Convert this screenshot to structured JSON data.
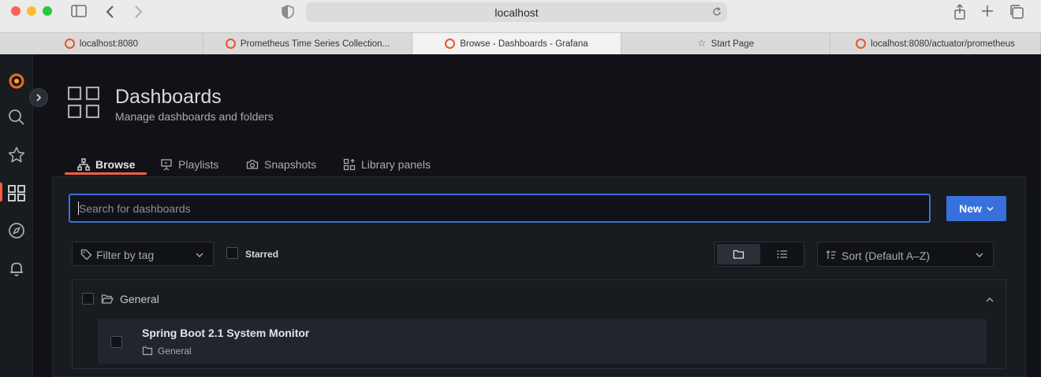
{
  "browser": {
    "url": "localhost",
    "tabs": [
      {
        "label": "localhost:8080",
        "icon": "grafana-icon"
      },
      {
        "label": "Prometheus Time Series Collection...",
        "icon": "grafana-icon"
      },
      {
        "label": "Browse - Dashboards - Grafana",
        "icon": "grafana-icon",
        "active": true
      },
      {
        "label": "Start Page",
        "icon": "star-icon"
      },
      {
        "label": "localhost:8080/actuator/prometheus",
        "icon": "grafana-icon"
      }
    ]
  },
  "header": {
    "title": "Dashboards",
    "subtitle": "Manage dashboards and folders"
  },
  "subtabs": [
    {
      "label": "Browse",
      "icon": "sitemap-icon",
      "active": true
    },
    {
      "label": "Playlists",
      "icon": "presentation-icon"
    },
    {
      "label": "Snapshots",
      "icon": "camera-icon"
    },
    {
      "label": "Library panels",
      "icon": "library-panel-icon"
    }
  ],
  "search": {
    "placeholder": "Search for dashboards"
  },
  "new_button": {
    "label": "New"
  },
  "filters": {
    "tag_placeholder": "Filter by tag",
    "starred_label": "Starred",
    "sort_label": "Sort (Default A–Z)"
  },
  "folder": {
    "name": "General"
  },
  "dashboards": [
    {
      "title": "Spring Boot 2.1 System Monitor",
      "folder": "General"
    }
  ],
  "colors": {
    "accent": "#f55f3e",
    "primary": "#3871dc",
    "background": "#111217"
  }
}
